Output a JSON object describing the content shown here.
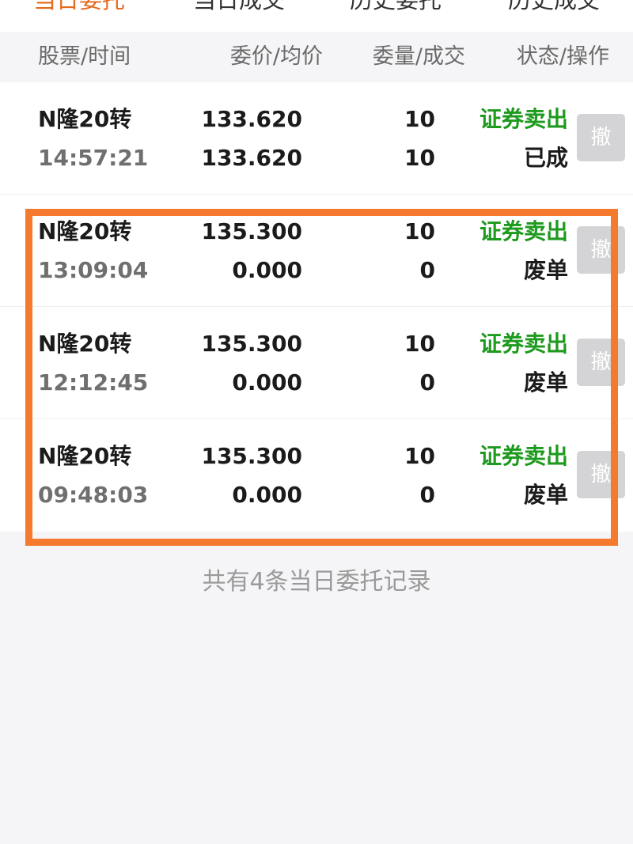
{
  "tabs": [
    {
      "label": "当日委托",
      "active": true
    },
    {
      "label": "当日成交",
      "active": false
    },
    {
      "label": "历史委托",
      "active": false
    },
    {
      "label": "历史成交",
      "active": false
    }
  ],
  "columns": {
    "stock_time": "股票/时间",
    "price_avg": "委价/均价",
    "qty_filled": "委量/成交",
    "status_action": "状态/操作"
  },
  "orders": [
    {
      "name": "N隆20转",
      "time": "14:57:21",
      "price": "133.620",
      "avg_price": "133.620",
      "qty": "10",
      "filled": "10",
      "side": "证券卖出",
      "status": "已成",
      "action": "撤"
    },
    {
      "name": "N隆20转",
      "time": "13:09:04",
      "price": "135.300",
      "avg_price": "0.000",
      "qty": "10",
      "filled": "0",
      "side": "证券卖出",
      "status": "废单",
      "action": "撤"
    },
    {
      "name": "N隆20转",
      "time": "12:12:45",
      "price": "135.300",
      "avg_price": "0.000",
      "qty": "10",
      "filled": "0",
      "side": "证券卖出",
      "status": "废单",
      "action": "撤"
    },
    {
      "name": "N隆20转",
      "time": "09:48:03",
      "price": "135.300",
      "avg_price": "0.000",
      "qty": "10",
      "filled": "0",
      "side": "证券卖出",
      "status": "废单",
      "action": "撤"
    }
  ],
  "summary": "共有4条当日委托记录",
  "colors": {
    "accent": "#e46a1e",
    "sell": "#1e9a1e",
    "highlight": "#f57a2e",
    "cancel_button": "#d4d4d6"
  }
}
